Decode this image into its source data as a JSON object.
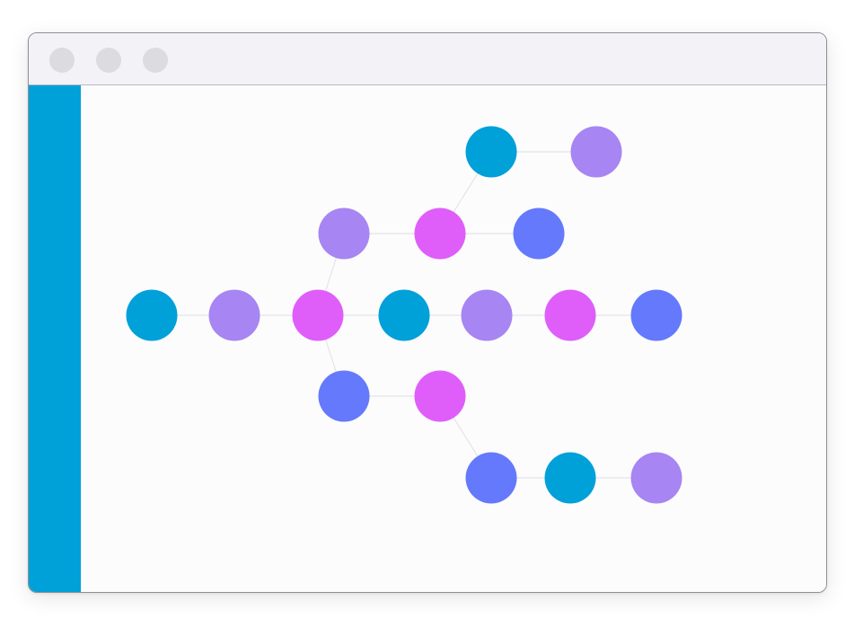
{
  "window": {
    "traffic_lights": [
      "close",
      "minimize",
      "zoom"
    ]
  },
  "sidebar": {
    "color": "#00a0d9"
  },
  "graph": {
    "colors": {
      "cyan": "#00a0d9",
      "lavender": "#a785f2",
      "magenta": "#df5ef9",
      "blue": "#6479fb",
      "edge": "#e4e4ea"
    },
    "nodes": [
      {
        "id": "n1",
        "color": "cyan"
      },
      {
        "id": "n2",
        "color": "lavender"
      },
      {
        "id": "n3",
        "color": "lavender"
      },
      {
        "id": "n4",
        "color": "magenta"
      },
      {
        "id": "n5",
        "color": "blue"
      },
      {
        "id": "n6",
        "color": "cyan"
      },
      {
        "id": "n7",
        "color": "lavender"
      },
      {
        "id": "n8",
        "color": "magenta"
      },
      {
        "id": "n9",
        "color": "cyan"
      },
      {
        "id": "n10",
        "color": "lavender"
      },
      {
        "id": "n11",
        "color": "magenta"
      },
      {
        "id": "n12",
        "color": "blue"
      },
      {
        "id": "n13",
        "color": "blue"
      },
      {
        "id": "n14",
        "color": "magenta"
      },
      {
        "id": "n15",
        "color": "blue"
      },
      {
        "id": "n16",
        "color": "cyan"
      },
      {
        "id": "n17",
        "color": "lavender"
      }
    ],
    "edges": [
      [
        "n1",
        "n2"
      ],
      [
        "n4",
        "n1"
      ],
      [
        "n4",
        "n5"
      ],
      [
        "n3",
        "n4"
      ],
      [
        "n8",
        "n3"
      ],
      [
        "n6",
        "n7"
      ],
      [
        "n7",
        "n8"
      ],
      [
        "n8",
        "n9"
      ],
      [
        "n9",
        "n10"
      ],
      [
        "n10",
        "n11"
      ],
      [
        "n11",
        "n12"
      ],
      [
        "n8",
        "n13"
      ],
      [
        "n13",
        "n14"
      ],
      [
        "n14",
        "n15"
      ],
      [
        "n15",
        "n16"
      ],
      [
        "n16",
        "n17"
      ]
    ]
  }
}
